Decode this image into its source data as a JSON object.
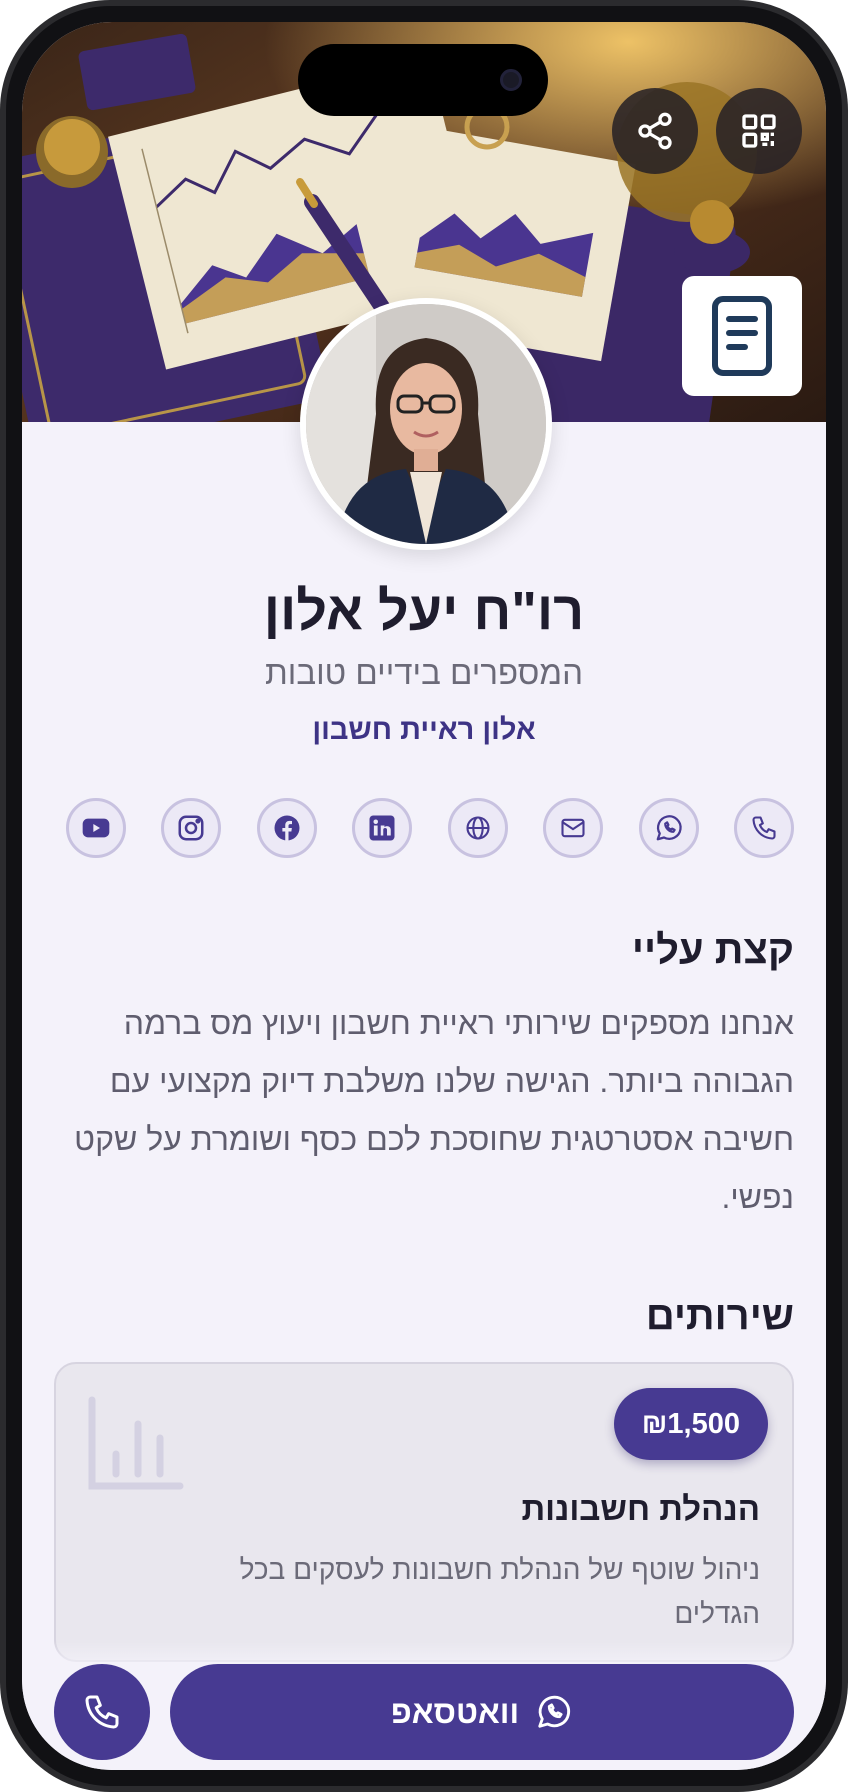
{
  "profile": {
    "name": "רו\"ח יעל אלון",
    "slogan": "המספרים בידיים טובות",
    "company": "אלון ראיית חשבון"
  },
  "social_links": [
    {
      "name": "phone-icon"
    },
    {
      "name": "whatsapp-icon"
    },
    {
      "name": "email-icon"
    },
    {
      "name": "globe-icon"
    },
    {
      "name": "linkedin-icon"
    },
    {
      "name": "facebook-icon"
    },
    {
      "name": "instagram-icon"
    },
    {
      "name": "youtube-icon"
    }
  ],
  "about": {
    "title": "קצת עליי",
    "text": "אנחנו מספקים שירותי ראיית חשבון ויעוץ מס ברמה הגבוהה ביותר. הגישה שלנו משלבת דיוק מקצועי עם חשיבה אסטרטגית שחוסכת לכם כסף ושומרת על שקט נפשי."
  },
  "services": {
    "title": "שירותים",
    "items": [
      {
        "price": "₪1,500",
        "name": "הנהלת חשבונות",
        "description": "ניהול שוטף של הנהלת חשבונות לעסקים בכל הגדלים"
      }
    ]
  },
  "actions": {
    "whatsapp_label": "וואטסאפ"
  },
  "colors": {
    "primary": "#473a92",
    "background": "#f4f2fa",
    "icon_ring": "#c8c2e0"
  }
}
